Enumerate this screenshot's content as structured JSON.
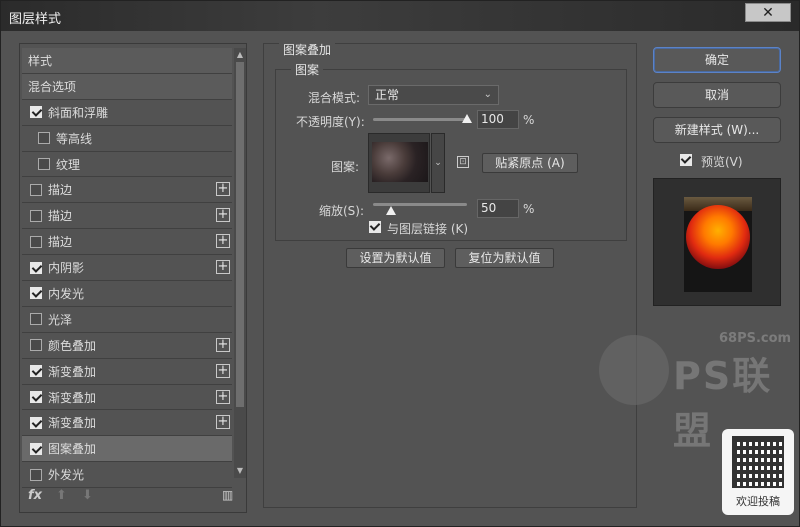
{
  "window": {
    "title": "图层样式",
    "close_glyph": "✕"
  },
  "styles_list": {
    "items": [
      {
        "label": "样式",
        "checkbox": false,
        "checked": false,
        "plus": false,
        "indent": false,
        "header": true
      },
      {
        "label": "混合选项",
        "checkbox": false,
        "checked": false,
        "plus": false,
        "indent": false,
        "header": true
      },
      {
        "label": "斜面和浮雕",
        "checkbox": true,
        "checked": true,
        "plus": false,
        "indent": false
      },
      {
        "label": "等高线",
        "checkbox": true,
        "checked": false,
        "plus": false,
        "indent": true
      },
      {
        "label": "纹理",
        "checkbox": true,
        "checked": false,
        "plus": false,
        "indent": true
      },
      {
        "label": "描边",
        "checkbox": true,
        "checked": false,
        "plus": true,
        "indent": false
      },
      {
        "label": "描边",
        "checkbox": true,
        "checked": false,
        "plus": true,
        "indent": false
      },
      {
        "label": "描边",
        "checkbox": true,
        "checked": false,
        "plus": true,
        "indent": false
      },
      {
        "label": "内阴影",
        "checkbox": true,
        "checked": true,
        "plus": true,
        "indent": false
      },
      {
        "label": "内发光",
        "checkbox": true,
        "checked": true,
        "plus": false,
        "indent": false
      },
      {
        "label": "光泽",
        "checkbox": true,
        "checked": false,
        "plus": false,
        "indent": false
      },
      {
        "label": "颜色叠加",
        "checkbox": true,
        "checked": false,
        "plus": true,
        "indent": false
      },
      {
        "label": "渐变叠加",
        "checkbox": true,
        "checked": true,
        "plus": true,
        "indent": false
      },
      {
        "label": "渐变叠加",
        "checkbox": true,
        "checked": true,
        "plus": true,
        "indent": false
      },
      {
        "label": "渐变叠加",
        "checkbox": true,
        "checked": true,
        "plus": true,
        "indent": false
      },
      {
        "label": "图案叠加",
        "checkbox": true,
        "checked": true,
        "plus": false,
        "indent": false,
        "selected": true
      },
      {
        "label": "外发光",
        "checkbox": true,
        "checked": false,
        "plus": false,
        "indent": false
      }
    ],
    "toolbar": {
      "fx": "fx",
      "up": "⬆",
      "down": "⬇",
      "trash": "🗑"
    }
  },
  "pattern_overlay": {
    "group_title": "图案叠加",
    "sub_title": "图案",
    "blend_mode_label": "混合模式:",
    "blend_mode_value": "正常",
    "opacity_label": "不透明度(Y):",
    "opacity_value": "100",
    "opacity_unit": "%",
    "opacity_fraction": 1.0,
    "pattern_label": "图案:",
    "snap_origin_label": "贴紧原点 (A)",
    "scale_label": "缩放(S):",
    "scale_value": "50",
    "scale_unit": "%",
    "scale_fraction": 0.5,
    "link_label": "与图层链接 (K)",
    "link_checked": true,
    "set_default_label": "设置为默认值",
    "reset_default_label": "复位为默认值"
  },
  "right_panel": {
    "ok_label": "确定",
    "cancel_label": "取消",
    "new_style_label": "新建样式 (W)...",
    "preview_label": "预览(V)",
    "preview_checked": true
  },
  "watermark": {
    "site": "68PS.com",
    "brand": "PS联盟",
    "qr_caption": "欢迎投稿"
  }
}
